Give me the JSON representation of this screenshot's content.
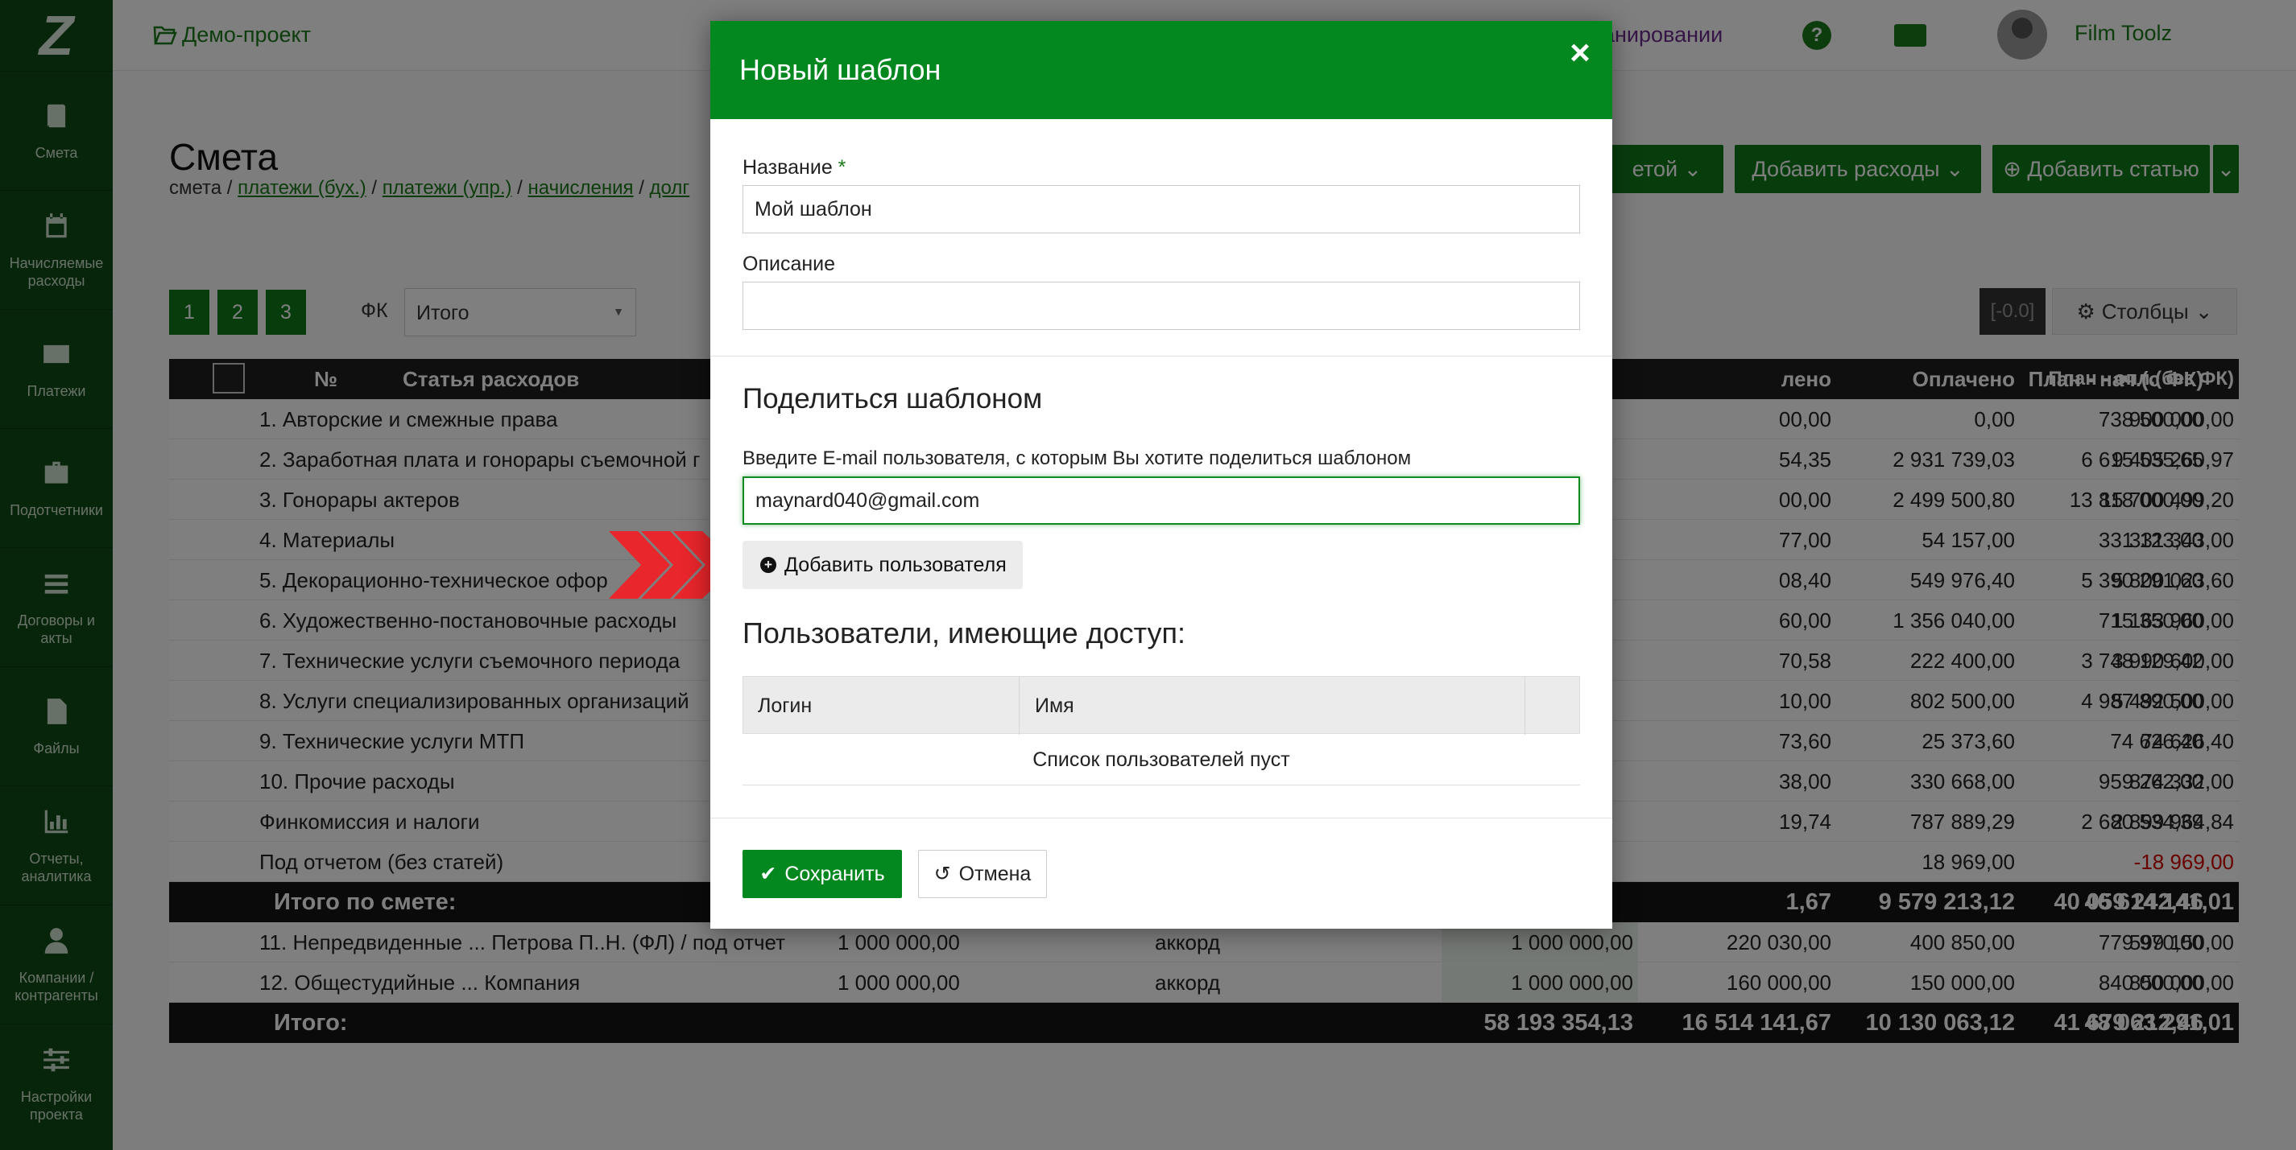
{
  "sidebar": {
    "logo": "Z",
    "items": [
      {
        "label": "Смета",
        "icon": "book-icon"
      },
      {
        "label": "Начисляемые расходы",
        "icon": "calendar-icon"
      },
      {
        "label": "Платежи",
        "icon": "credit-card-icon"
      },
      {
        "label": "Подотчетники",
        "icon": "briefcase-icon"
      },
      {
        "label": "Договоры и акты",
        "icon": "list-icon"
      },
      {
        "label": "Файлы",
        "icon": "file-icon"
      },
      {
        "label": "Отчеты, аналитика",
        "icon": "bar-chart-icon"
      },
      {
        "label": "Компании / контрагенты",
        "icon": "user-icon"
      },
      {
        "label": "Настройки проекта",
        "icon": "sliders-icon"
      }
    ]
  },
  "topbar": {
    "project": "Демо-проект",
    "link_partial": "анировании",
    "user": "Film Toolz",
    "lang": "RU"
  },
  "page": {
    "title": "Смета",
    "crumb_plain": "смета / ",
    "crumbs": [
      "платежи (бух.)",
      "платежи (упр.)",
      "начисления",
      "долг"
    ],
    "btn_partial": "етой",
    "btn_add_expenses": "Добавить расходы",
    "btn_add_article": "Добавить статью",
    "pages": [
      "1",
      "2",
      "3"
    ],
    "fk_label": "ФК",
    "fk_value": "Итого",
    "range_chip": "[-0.0]",
    "columns_btn": "Столбцы"
  },
  "table": {
    "headers": {
      "no": "№",
      "article": "Статья расходов",
      "col_a": "лено",
      "col_b": "Оплачено",
      "col_c": "План - нач.(с ФК)",
      "col_d": "План - опл.(без ФК)"
    },
    "rows": [
      {
        "name": "1. Авторские и смежные права",
        "a": "00,00",
        "b": "0,00",
        "c": "738 500,00",
        "d": "900 000,00"
      },
      {
        "name": "2. Заработная плата и гонорары съемочной г",
        "a": "54,35",
        "b": "2 931 739,03",
        "c": "6 615 535,65",
        "d": "9 405 260,97"
      },
      {
        "name": "3. Гонорары актеров",
        "a": "00,00",
        "b": "2 499 500,80",
        "c": "13 818 000,00",
        "d": "15 700 499,20"
      },
      {
        "name": "4. Материалы",
        "a": "77,00",
        "b": "54 157,00",
        "c": "331 123,00",
        "d": "331 343,00"
      },
      {
        "name": "5. Декорационно-техническое офор",
        "a": "08,40",
        "b": "549 976,40",
        "c": "5 390 291,60",
        "d": "5 800 023,60"
      },
      {
        "name": "6. Художественно-постановочные расходы",
        "a": "60,00",
        "b": "1 356 040,00",
        "c": "715 350,00",
        "d": "1 163 960,00"
      },
      {
        "name": "7. Технические услуги съемочного периода",
        "a": "70,58",
        "b": "222 400,00",
        "c": "3 748 129,42",
        "d": "3 990 600,00"
      },
      {
        "name": "8. Услуги специализированных организаций",
        "a": "10,00",
        "b": "802 500,00",
        "c": "4 987 890,00",
        "d": "5 492 500,00"
      },
      {
        "name": "9. Технические услуги МТП",
        "a": "73,60",
        "b": "25 373,60",
        "c": "74 626,40",
        "d": "74 626,40"
      },
      {
        "name": "10. Прочие расходы",
        "a": "38,00",
        "b": "330 668,00",
        "c": "959 262,00",
        "d": "874 332,00"
      },
      {
        "name": "Финкомиссия и налоги",
        "a": "19,74",
        "b": "787 889,29",
        "c": "2 680 534,39",
        "d": "2 899 964,84"
      },
      {
        "name": "Под отчетом (без статей)",
        "a": "",
        "b": "18 969,00",
        "c": "",
        "d": "-18 969,00"
      }
    ],
    "subtotal": {
      "name": "Итого по смете:",
      "a": "1,67",
      "b": "9 579 213,12",
      "c": "40 059 242,46",
      "d": "46 614 141,01"
    },
    "extra_rows": [
      {
        "name": "11. Непредвиденные ... Петрова П..Н. (ФЛ) / под отчет",
        "amount": "1 000 000,00",
        "mode": "аккорд",
        "plan": "1 000 000,00",
        "a": "220 030,00",
        "b": "400 850,00",
        "c": "779 970,00",
        "d": "599 150,00"
      },
      {
        "name": "12. Общестудийные ... Компания",
        "amount": "1 000 000,00",
        "mode": "аккорд",
        "plan": "1 000 000,00",
        "a": "160 000,00",
        "b": "150 000,00",
        "c": "840 000,00",
        "d": "850 000,00"
      }
    ],
    "total": {
      "name": "Итого:",
      "plan": "58 193 354,13",
      "a": "16 514 141,67",
      "b": "10 130 063,12",
      "c": "41 679 212,46",
      "d": "48 063 291,01"
    }
  },
  "modal": {
    "title": "Новый шаблон",
    "close": "×",
    "name_label": "Название",
    "required_mark": "*",
    "name_value": "Мой шаблон",
    "desc_label": "Описание",
    "desc_value": "",
    "share_heading": "Поделиться шаблоном",
    "email_label": "Введите E-mail пользователя, с которым Вы хотите поделиться шаблоном",
    "email_value": "maynard040@gmail.com",
    "add_user": "Добавить пользователя",
    "access_heading": "Пользователи, имеющие доступ:",
    "col_login": "Логин",
    "col_name": "Имя",
    "empty_text": "Список пользователей пуст",
    "save": "Сохранить",
    "cancel": "Отмена"
  },
  "colors": {
    "accent": "#03871f",
    "sidebar": "#0f4a16",
    "arrows": "#e8262b"
  }
}
